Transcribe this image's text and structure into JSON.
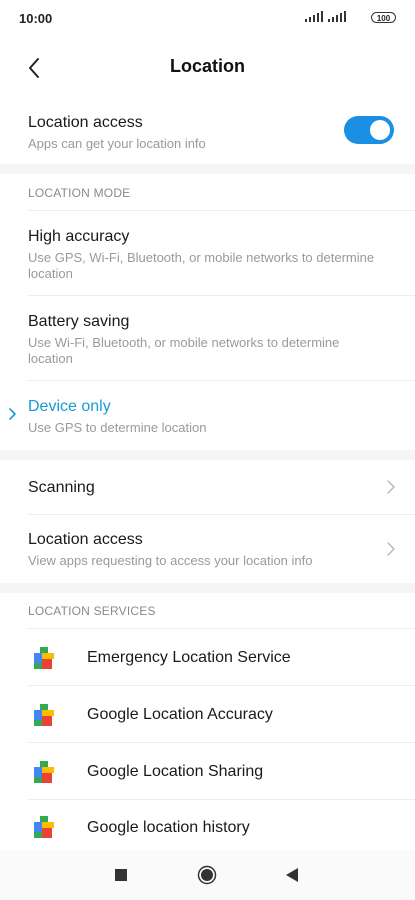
{
  "status_bar": {
    "time": "10:00",
    "battery": "100"
  },
  "header": {
    "title": "Location"
  },
  "location_access_toggle": {
    "title": "Location access",
    "subtitle": "Apps can get your location info",
    "enabled": true
  },
  "location_mode": {
    "header": "LOCATION MODE",
    "options": [
      {
        "title": "High accuracy",
        "subtitle": "Use GPS, Wi-Fi, Bluetooth, or mobile networks to determine location",
        "selected": false
      },
      {
        "title": "Battery saving",
        "subtitle": "Use Wi-Fi, Bluetooth, or mobile networks to determine location",
        "selected": false
      },
      {
        "title": "Device only",
        "subtitle": "Use GPS to determine location",
        "selected": true
      }
    ]
  },
  "links": {
    "scanning": "Scanning",
    "location_access": {
      "title": "Location access",
      "subtitle": "View apps requesting to access your location info"
    }
  },
  "location_services": {
    "header": "LOCATION SERVICES",
    "items": [
      {
        "label": "Emergency Location Service",
        "icon": "play-services-icon"
      },
      {
        "label": "Google Location Accuracy",
        "icon": "play-services-icon"
      },
      {
        "label": "Google Location Sharing",
        "icon": "play-services-icon"
      },
      {
        "label": "Google location history",
        "icon": "play-services-icon"
      }
    ]
  },
  "colors": {
    "accent": "#1a8fe3",
    "selected_text": "#1a9ad6"
  }
}
